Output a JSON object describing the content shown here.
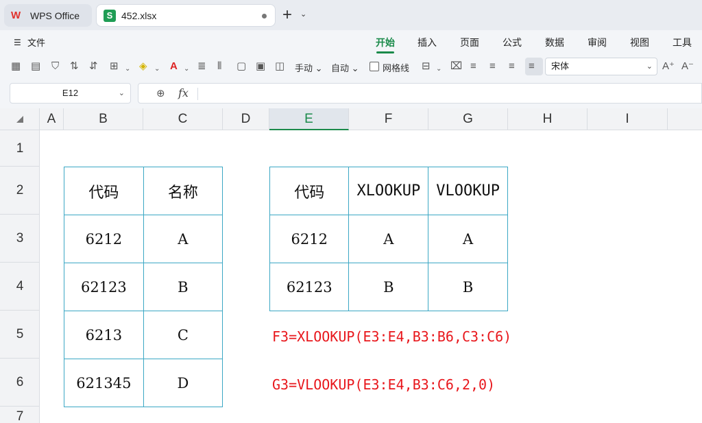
{
  "titlebar": {
    "app_tab": "WPS Office",
    "file_tab": "452.xlsx"
  },
  "ribbon": {
    "file_menu": "文件",
    "tabs": [
      "开始",
      "插入",
      "页面",
      "公式",
      "数据",
      "审阅",
      "视图",
      "工具"
    ],
    "active_tab": "开始"
  },
  "toolbar": {
    "manual_label": "手动",
    "auto_label": "自动",
    "gridlines_label": "网格线",
    "gridlines_checked": false,
    "font_name": "宋体"
  },
  "formula_bar": {
    "cell_ref": "E12",
    "formula": ""
  },
  "grid": {
    "columns": [
      "A",
      "B",
      "C",
      "D",
      "E",
      "F",
      "G",
      "H",
      "I"
    ],
    "selected_column": "E",
    "rows": [
      "1",
      "2",
      "3",
      "4",
      "5",
      "6",
      "7"
    ]
  },
  "source_table": {
    "headers": [
      "代码",
      "名称"
    ],
    "rows": [
      [
        "6212",
        "A"
      ],
      [
        "62123",
        "B"
      ],
      [
        "6213",
        "C"
      ],
      [
        "621345",
        "D"
      ]
    ]
  },
  "result_table": {
    "headers": [
      "代码",
      "XLOOKUP",
      "VLOOKUP"
    ],
    "rows": [
      [
        "6212",
        "A",
        "A"
      ],
      [
        "62123",
        "B",
        "B"
      ]
    ]
  },
  "formulas": {
    "f3": "F3=XLOOKUP(E3:E4,B3:B6,C3:C6)",
    "g3": "G3=VLOOKUP(E3:E4,B3:C6,2,0)"
  },
  "colors": {
    "accent": "#1a8a4a",
    "table_border": "#3aa7c4",
    "formula_text": "#e8161b"
  }
}
